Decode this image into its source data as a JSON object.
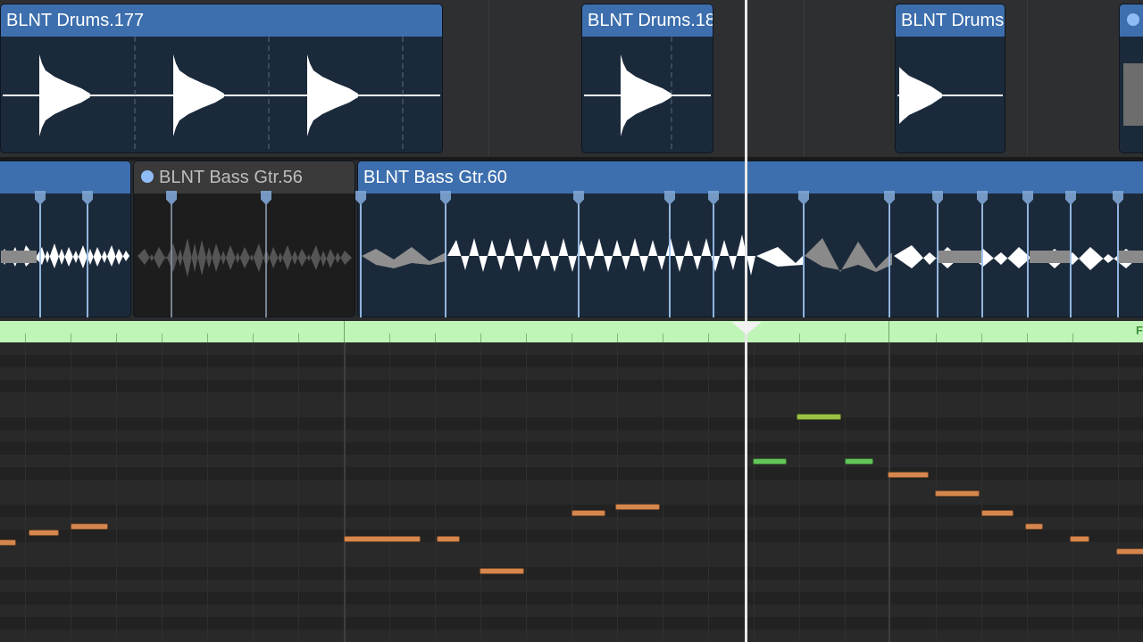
{
  "drum_track": {
    "regions": [
      {
        "name": "BLNT Drums.177"
      },
      {
        "name": "BLNT Drums.18"
      },
      {
        "name": "BLNT Drums"
      },
      {
        "name": ""
      }
    ]
  },
  "bass_track": {
    "regions": [
      {
        "name": ""
      },
      {
        "name": "BLNT Bass Gtr.56",
        "muted": true,
        "selected_dot": true
      },
      {
        "name": "BLNT Bass Gtr.60"
      }
    ]
  },
  "colors": {
    "region_header": "#3d6fae",
    "region_body": "#1b2a3b",
    "muted_header": "#3a3a3a",
    "ruler": "#bff5b7",
    "note_orange": "#d6874e",
    "note_green": "#63c659",
    "note_yellow_green": "#9cc244",
    "playhead": "#e8e8e8"
  },
  "ruler_corner_label": "F",
  "piano_roll": {
    "notes": [
      {
        "color": "note_orange"
      },
      {
        "color": "note_orange"
      },
      {
        "color": "note_orange"
      },
      {
        "color": "note_orange"
      },
      {
        "color": "note_orange"
      },
      {
        "color": "note_orange"
      },
      {
        "color": "note_orange"
      },
      {
        "color": "note_orange"
      },
      {
        "color": "note_green"
      },
      {
        "color": "note_yellow_green"
      },
      {
        "color": "note_green"
      },
      {
        "color": "note_orange"
      },
      {
        "color": "note_orange"
      },
      {
        "color": "note_orange"
      },
      {
        "color": "note_orange"
      },
      {
        "color": "note_orange"
      },
      {
        "color": "note_orange"
      }
    ]
  }
}
